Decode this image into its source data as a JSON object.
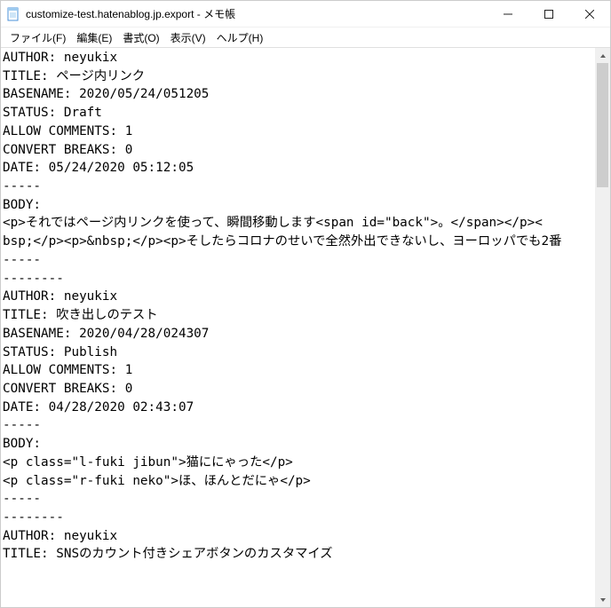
{
  "window": {
    "title": "customize-test.hatenablog.jp.export - メモ帳"
  },
  "menu": {
    "file": "ファイル(F)",
    "edit": "編集(E)",
    "format": "書式(O)",
    "view": "表示(V)",
    "help": "ヘルプ(H)"
  },
  "text_lines": [
    "AUTHOR: neyukix",
    "TITLE: ページ内リンク",
    "BASENAME: 2020/05/24/051205",
    "STATUS: Draft",
    "ALLOW COMMENTS: 1",
    "CONVERT BREAKS: 0",
    "DATE: 05/24/2020 05:12:05",
    "-----",
    "BODY:",
    "<p>それではページ内リンクを使って、瞬間移動します<span id=\"back\">。</span></p><",
    "bsp;</p><p>&nbsp;</p><p>そしたらコロナのせいで全然外出できないし、ヨーロッパでも2番",
    "-----",
    "--------",
    "AUTHOR: neyukix",
    "TITLE: 吹き出しのテスト",
    "BASENAME: 2020/04/28/024307",
    "STATUS: Publish",
    "ALLOW COMMENTS: 1",
    "CONVERT BREAKS: 0",
    "DATE: 04/28/2020 02:43:07",
    "-----",
    "BODY:",
    "<p class=\"l-fuki jibun\">猫ににゃった</p>",
    "<p class=\"r-fuki neko\">ほ、ほんとだにゃ</p>",
    "-----",
    "--------",
    "AUTHOR: neyukix",
    "TITLE: SNSのカウント付きシェアボタンのカスタマイズ"
  ]
}
